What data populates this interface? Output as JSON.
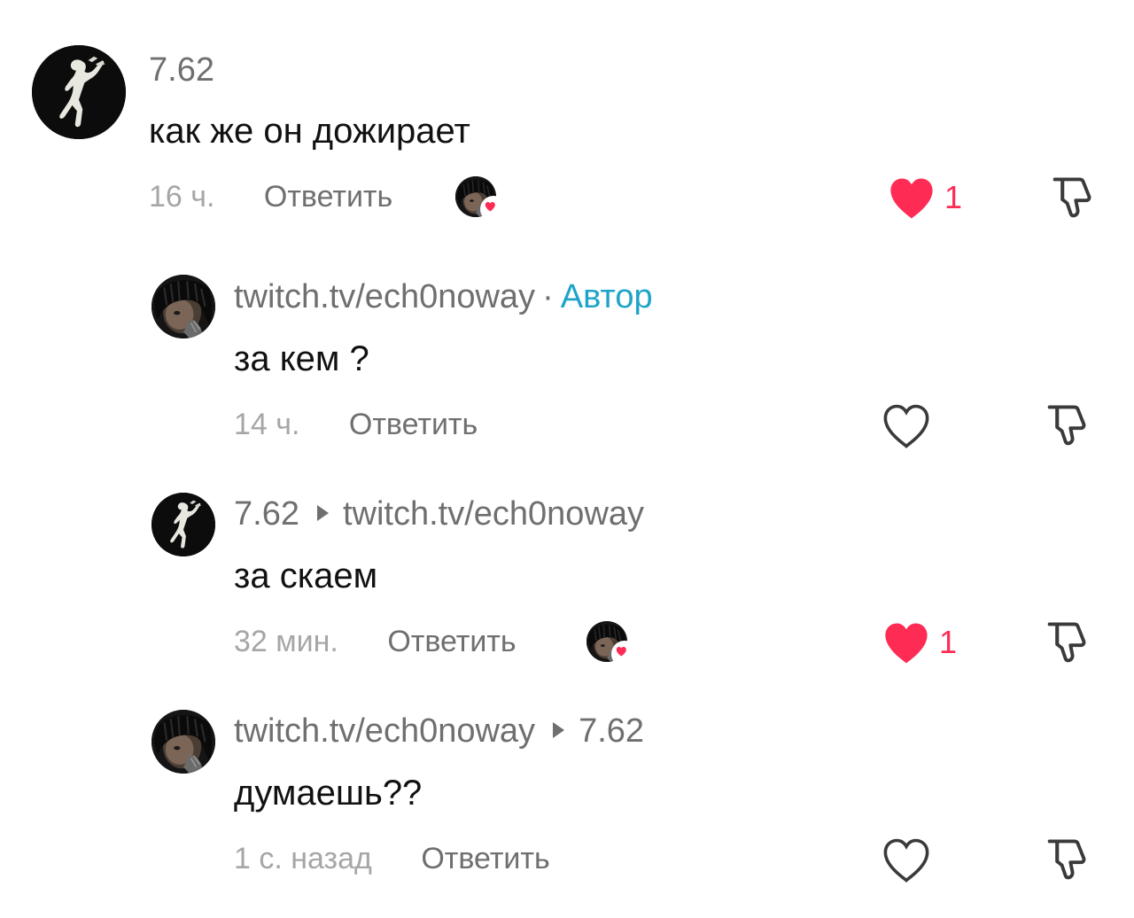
{
  "comments": [
    {
      "username": "7.62",
      "text": "как же он дожирает",
      "time": "16 ч.",
      "reply_label": "Ответить",
      "likes": "1",
      "liked": true,
      "creator_liked": true,
      "avatar_icon": "dancing-figure-icon"
    },
    {
      "username": "twitch.tv/ech0noway",
      "separator": "·",
      "badge": "Автор",
      "text": "за кем ?",
      "time": "14 ч.",
      "reply_label": "Ответить",
      "liked": false,
      "avatar_icon": "dark-portrait-icon"
    },
    {
      "username": "7.62",
      "reply_to": "twitch.tv/ech0noway",
      "text": "за скаем",
      "time": "32 мин.",
      "reply_label": "Ответить",
      "likes": "1",
      "liked": true,
      "creator_liked": true,
      "avatar_icon": "dancing-figure-icon"
    },
    {
      "username": "twitch.tv/ech0noway",
      "reply_to": "7.62",
      "text": "думаешь??",
      "time": "1 с. назад",
      "reply_label": "Ответить",
      "liked": false,
      "avatar_icon": "dark-portrait-icon"
    }
  ],
  "colors": {
    "like_red": "#fe2c55",
    "author_blue": "#1ea4c9",
    "secondary_text": "#6f6f6f",
    "time_text": "#a6a6a6"
  }
}
